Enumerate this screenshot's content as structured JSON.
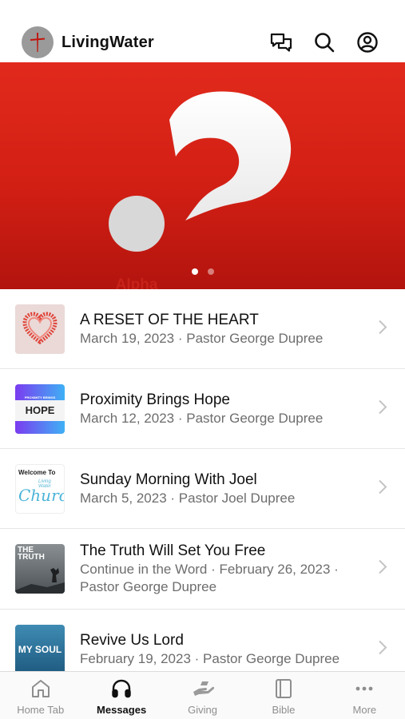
{
  "header": {
    "title": "LivingWater",
    "icons": [
      "logo-cross-icon",
      "chat-icon",
      "search-icon",
      "account-icon"
    ]
  },
  "hero": {
    "badge_text": "Alpha",
    "slides": 2,
    "active_slide": 1
  },
  "messages": [
    {
      "title": "A RESET OF THE HEART",
      "meta": "March 19, 2023 · Pastor George Dupree",
      "thumb": "heart"
    },
    {
      "title": "Proximity Brings Hope",
      "meta": "March 12, 2023 · Pastor George Dupree",
      "thumb": "hope",
      "thumb_small": "PROXIMITY BRINGS",
      "thumb_big": "HOPE"
    },
    {
      "title": "Sunday Morning With Joel",
      "meta": "March 5, 2023 · Pastor Joel Dupree",
      "thumb": "church",
      "thumb_top": "Welcome To",
      "thumb_script": "Living Water",
      "thumb_word": "Church"
    },
    {
      "title": "The Truth Will Set You Free",
      "meta": "Continue in the Word · February 26, 2023 · Pastor George Dupree",
      "thumb": "truth",
      "thumb_word": "THE TRUTH"
    },
    {
      "title": "Revive Us Lord",
      "meta": "February 19, 2023 · Pastor George Dupree",
      "thumb": "soul",
      "thumb_word": "MY SOUL"
    }
  ],
  "tabs": [
    {
      "label": "Home Tab",
      "icon": "home-icon",
      "active": false
    },
    {
      "label": "Messages",
      "icon": "headphones-icon",
      "active": true
    },
    {
      "label": "Giving",
      "icon": "giving-hand-icon",
      "active": false
    },
    {
      "label": "Bible",
      "icon": "bible-book-icon",
      "active": false
    },
    {
      "label": "More",
      "icon": "more-dots-icon",
      "active": false
    }
  ],
  "colors": {
    "hero_red": "#d21f14",
    "text_primary": "#111111",
    "text_secondary": "#6d6d6d",
    "tab_inactive": "#8e8e8e"
  }
}
